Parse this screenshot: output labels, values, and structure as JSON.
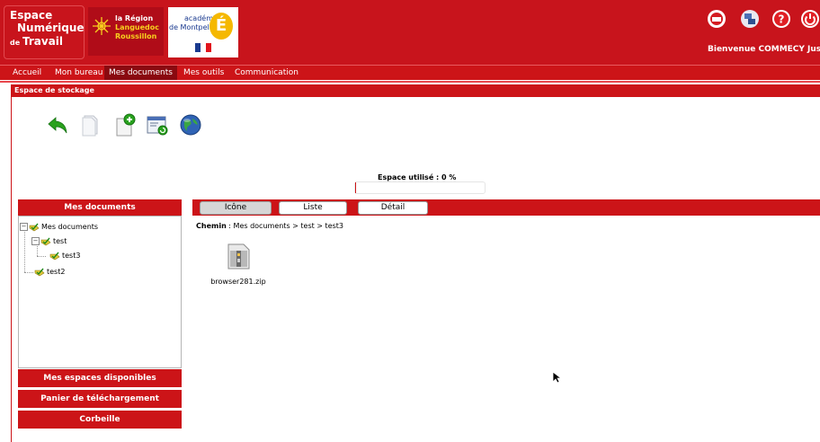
{
  "header": {
    "ent_logo": {
      "line1": "Espace",
      "line2": "Numérique",
      "line3a": "de",
      "line3b": "Travail"
    },
    "region_logo": {
      "line1": "la Région",
      "line2": "Languedoc",
      "line3": "Roussillon"
    },
    "academie_logo": {
      "line1": "académie",
      "line2": "de Montpellier",
      "letter": "É"
    },
    "icons": [
      "ent-home-icon",
      "network-icon",
      "help-icon",
      "logout-icon"
    ],
    "welcome": "Bienvenue COMMECY Justin"
  },
  "nav": {
    "items": [
      {
        "label": "Accueil",
        "active": false
      },
      {
        "label": "Mon bureau",
        "active": false
      },
      {
        "label": "Mes documents",
        "active": true
      },
      {
        "label": "Mes outils",
        "active": false
      },
      {
        "label": "Communication",
        "active": false
      }
    ]
  },
  "section": {
    "title": "Espace de stockage"
  },
  "toolbar": {
    "icons": [
      "back-arrow-icon",
      "document-icon",
      "new-document-icon",
      "refresh-window-icon",
      "web-globe-icon"
    ]
  },
  "usage": {
    "label": "Espace utilisé : 0 %",
    "percent": 0
  },
  "left_panel": {
    "title": "Mes documents",
    "tree": [
      {
        "label": "Mes documents",
        "level": 0
      },
      {
        "label": "test",
        "level": 1
      },
      {
        "label": "test3",
        "level": 2
      },
      {
        "label": "test2",
        "level": 1
      }
    ],
    "buttons": [
      "Mes espaces disponibles",
      "Panier de téléchargement",
      "Corbeille"
    ]
  },
  "view_bar": {
    "buttons": [
      {
        "label": "Icône",
        "active": true
      },
      {
        "label": "Liste",
        "active": false
      },
      {
        "label": "Détail",
        "active": false
      }
    ]
  },
  "path": {
    "label": "Chemin",
    "value": " : Mes documents > test > test3"
  },
  "files": [
    {
      "name": "browser281.zip",
      "icon": "zip-archive-icon"
    }
  ],
  "colors": {
    "brand_red": "#cc1418",
    "dark_red": "#8a0a10",
    "header_red": "#c8141c"
  }
}
